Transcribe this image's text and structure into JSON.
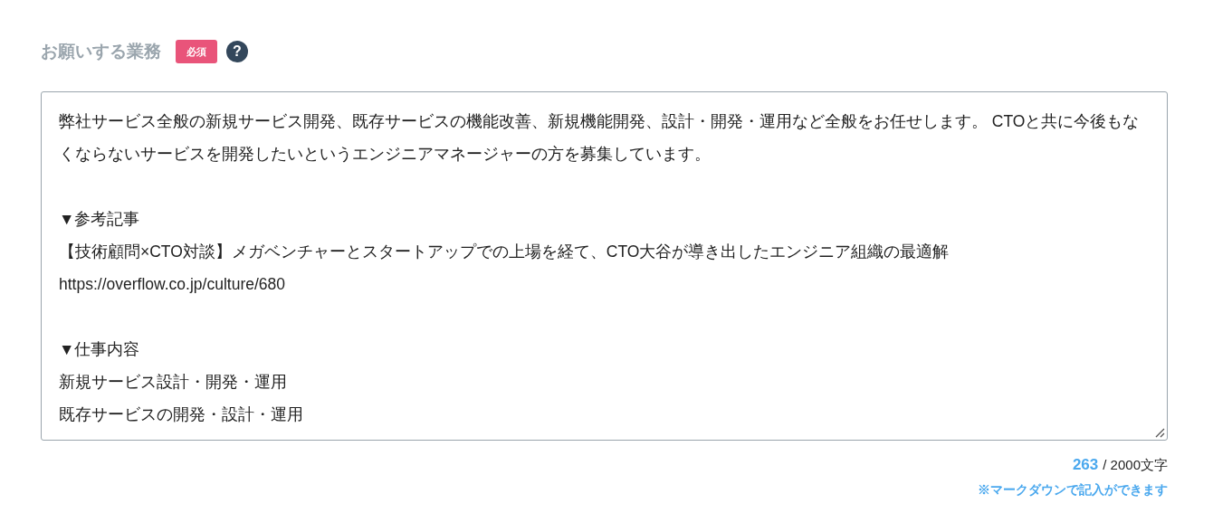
{
  "field": {
    "label": "お願いする業務",
    "required_badge": "必須",
    "help": "?",
    "sections": [
      [
        "弊社サービス全般の新規サービス開発、既存サービスの機能改善、新規機能開発、設計・開発・運用など全般をお任せします。 CTOと共に今後もなくならないサービスを開発したいというエンジニアマネージャーの方を募集しています。"
      ],
      [
        "▼参考記事",
        "【技術顧問×CTO対談】メガベンチャーとスタートアップでの上場を経て、CTO大谷が導き出したエンジニア組織の最適解",
        "https://overflow.co.jp/culture/680"
      ],
      [
        "▼仕事内容",
        "新規サービス設計・開発・運用",
        "既存サービスの開発・設計・運用"
      ]
    ],
    "count": "263",
    "limit": "/ 2000文字",
    "note": "※マークダウンで記入ができます"
  }
}
